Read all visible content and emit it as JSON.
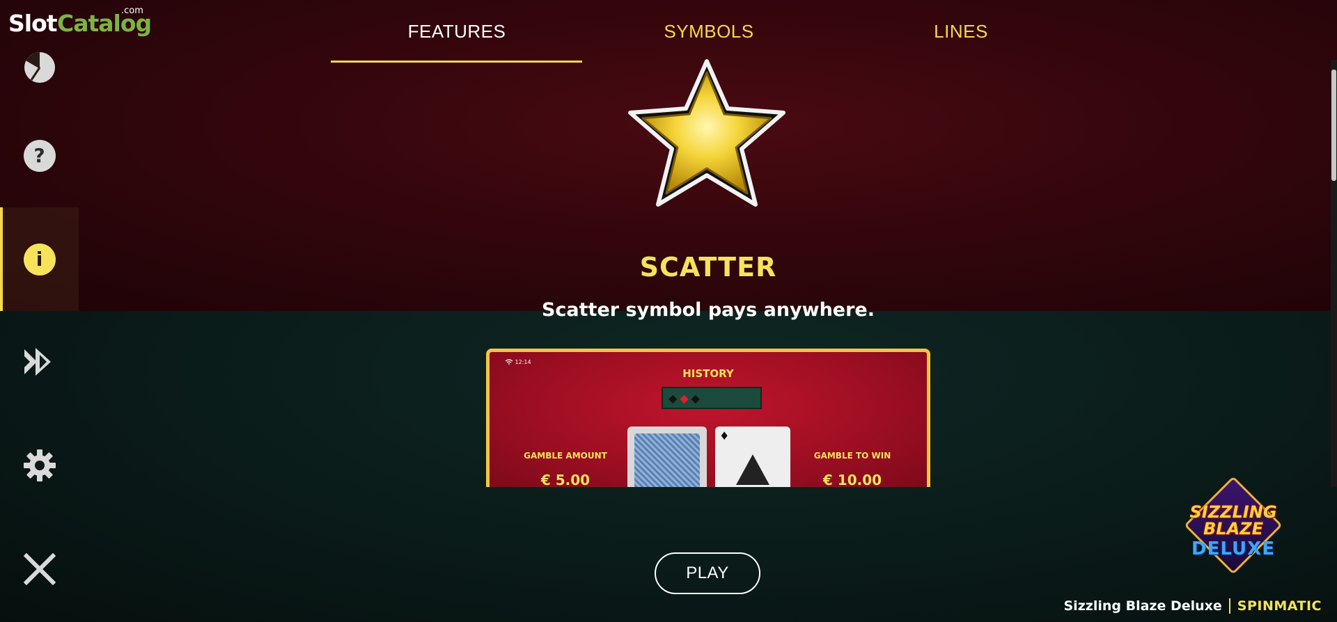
{
  "brand": {
    "slot": "Slot",
    "catalog": "Catalog",
    "com": ".com"
  },
  "sidebar": {
    "items": [
      {
        "name": "stats",
        "icon": "pie-chart-icon"
      },
      {
        "name": "help",
        "icon": "question-icon",
        "glyph": "?"
      },
      {
        "name": "info",
        "icon": "info-icon",
        "glyph": "i",
        "active": true
      },
      {
        "name": "autoplay",
        "icon": "fast-forward-icon"
      },
      {
        "name": "settings",
        "icon": "gear-icon"
      },
      {
        "name": "close",
        "icon": "close-icon"
      }
    ]
  },
  "tabs": [
    {
      "label": "FEATURES",
      "active": true
    },
    {
      "label": "SYMBOLS",
      "active": false
    },
    {
      "label": "LINES",
      "active": false
    }
  ],
  "feature": {
    "title": "SCATTER",
    "description": "Scatter symbol pays anywhere."
  },
  "preview": {
    "status": "12:14",
    "history_label": "HISTORY",
    "gamble_amount_label": "GAMBLE AMOUNT",
    "gamble_amount_value": "€ 5.00",
    "gamble_to_win_label": "GAMBLE TO WIN",
    "gamble_to_win_value": "€ 10.00"
  },
  "play_button": {
    "label": "PLAY"
  },
  "game_logo": {
    "line1": "SIZZLING",
    "line2": "BLAZE",
    "line3": "DELUXE"
  },
  "footer": {
    "game_name": "Sizzling Blaze Deluxe",
    "provider": "SPINMATIC"
  },
  "colors": {
    "accent": "#f5d94a",
    "logo_green": "#7cb342",
    "frame_gold": "#f2c542"
  }
}
